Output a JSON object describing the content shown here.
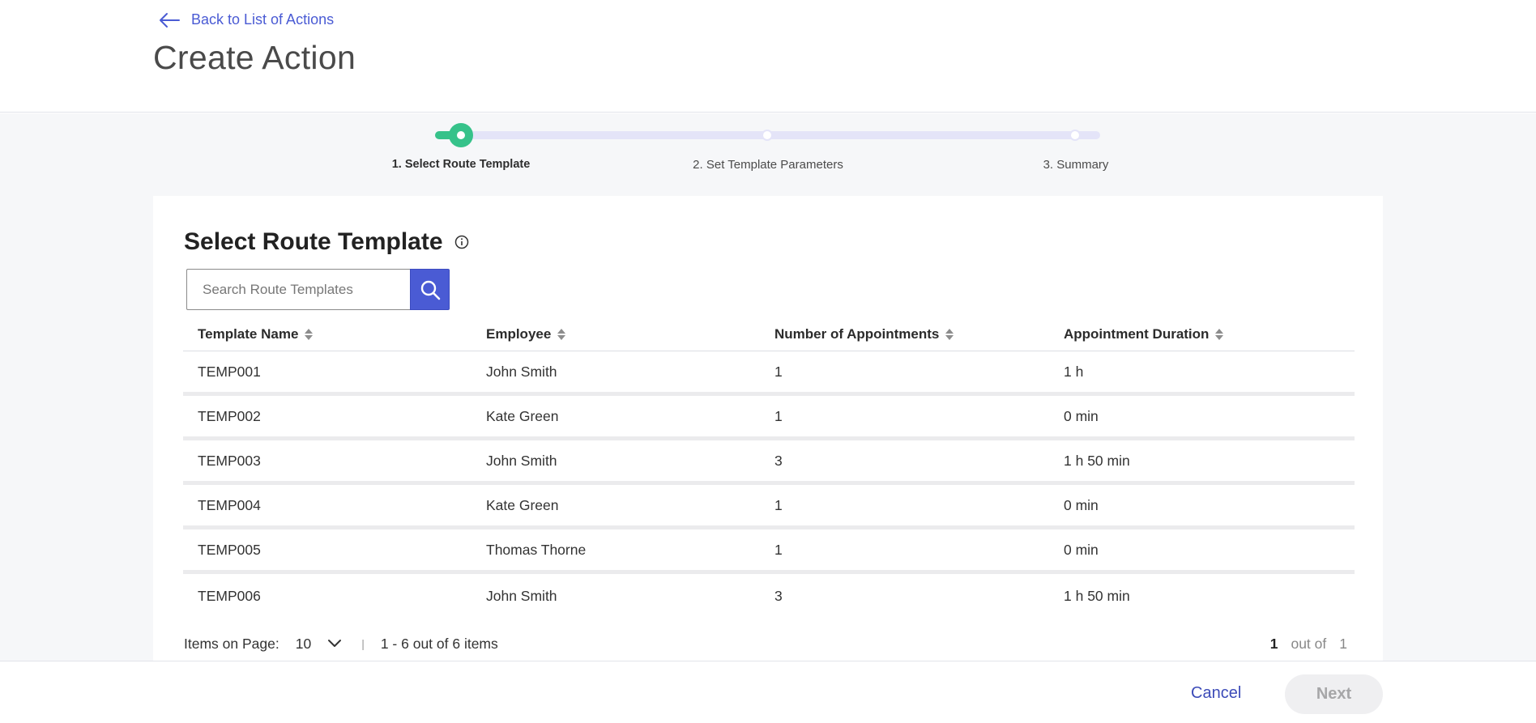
{
  "header": {
    "back_label": "Back to List of Actions",
    "title": "Create Action"
  },
  "stepper": {
    "steps": [
      {
        "label": "1. Select Route Template",
        "active": true
      },
      {
        "label": "2. Set Template Parameters",
        "active": false
      },
      {
        "label": "3. Summary",
        "active": false
      }
    ],
    "accent_color": "#36c28a",
    "track_color": "#e4e4f8"
  },
  "card": {
    "title": "Select Route Template",
    "info_icon": "info-icon"
  },
  "search": {
    "placeholder": "Search Route Templates",
    "value": "",
    "icon": "search-icon",
    "button_color": "#4a5bd4"
  },
  "table": {
    "columns": [
      "Template Name",
      "Employee",
      "Number of Appointments",
      "Appointment Duration"
    ],
    "rows": [
      [
        "TEMP001",
        "John Smith",
        "1",
        "1 h"
      ],
      [
        "TEMP002",
        "Kate Green",
        "1",
        "0 min"
      ],
      [
        "TEMP003",
        "John Smith",
        "3",
        "1 h 50 min"
      ],
      [
        "TEMP004",
        "Kate Green",
        "1",
        "0 min"
      ],
      [
        "TEMP005",
        "Thomas Thorne",
        "1",
        "0 min"
      ],
      [
        "TEMP006",
        "John Smith",
        "3",
        "1 h 50 min"
      ]
    ]
  },
  "pagination": {
    "items_label": "Items on Page:",
    "page_size": "10",
    "separator": "|",
    "range_text": "1 - 6 out of 6 items",
    "current_page": "1",
    "out_of_label": "out of",
    "total_pages": "1"
  },
  "footer": {
    "cancel_label": "Cancel",
    "next_label": "Next",
    "link_color": "#3c4bb8"
  }
}
